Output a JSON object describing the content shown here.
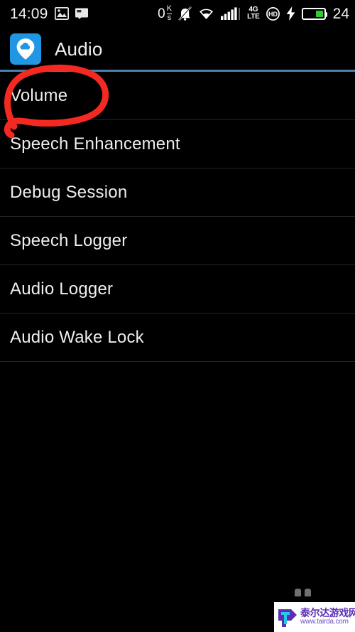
{
  "status_bar": {
    "clock": "14:09",
    "left_icons": [
      {
        "name": "image-icon",
        "glyph": "picture"
      },
      {
        "name": "message-card-icon",
        "glyph": "card"
      }
    ],
    "network_speed": {
      "value": "0",
      "unit_top": "K",
      "unit_bottom": "s"
    },
    "right_icons": [
      {
        "name": "ringer-muted-icon",
        "glyph": "bell-slash"
      },
      {
        "name": "wifi-icon",
        "glyph": "wifi"
      },
      {
        "name": "cellular-signal-icon",
        "glyph": "bars"
      },
      {
        "name": "volte-hd-icon",
        "glyph": "hd-badge"
      },
      {
        "name": "charging-bolt-icon",
        "glyph": "bolt"
      }
    ],
    "lte_label_top": "4G",
    "lte_label_bottom": "LTE",
    "hd_badge_label": "HD",
    "battery_percent": "24",
    "battery_level_pct": 38,
    "battery_fill_color": "#2ecc2e"
  },
  "header": {
    "app_title": "Audio",
    "icon_name": "audio-app-pin-cloud-icon",
    "icon_bg_color": "#2196e3",
    "divider_color": "#4a7fae"
  },
  "list": {
    "items": [
      {
        "label": "Volume",
        "name": "list-item-volume",
        "annotated": true
      },
      {
        "label": "Speech Enhancement",
        "name": "list-item-speech-enhancement",
        "annotated": false
      },
      {
        "label": "Debug Session",
        "name": "list-item-debug-session",
        "annotated": false
      },
      {
        "label": "Speech Logger",
        "name": "list-item-speech-logger",
        "annotated": false
      },
      {
        "label": "Audio Logger",
        "name": "list-item-audio-logger",
        "annotated": false
      },
      {
        "label": "Audio Wake Lock",
        "name": "list-item-audio-wake-lock",
        "annotated": false
      }
    ]
  },
  "annotation": {
    "type": "hand-drawn-ellipse",
    "target_label": "Volume",
    "color": "#f42a22",
    "stroke_width": 9
  },
  "watermark": {
    "site_name_cn": "泰尔达游戏网",
    "site_url": "www.tairda.com",
    "logo_letter": "T",
    "logo_color": "#5b2fb5"
  }
}
